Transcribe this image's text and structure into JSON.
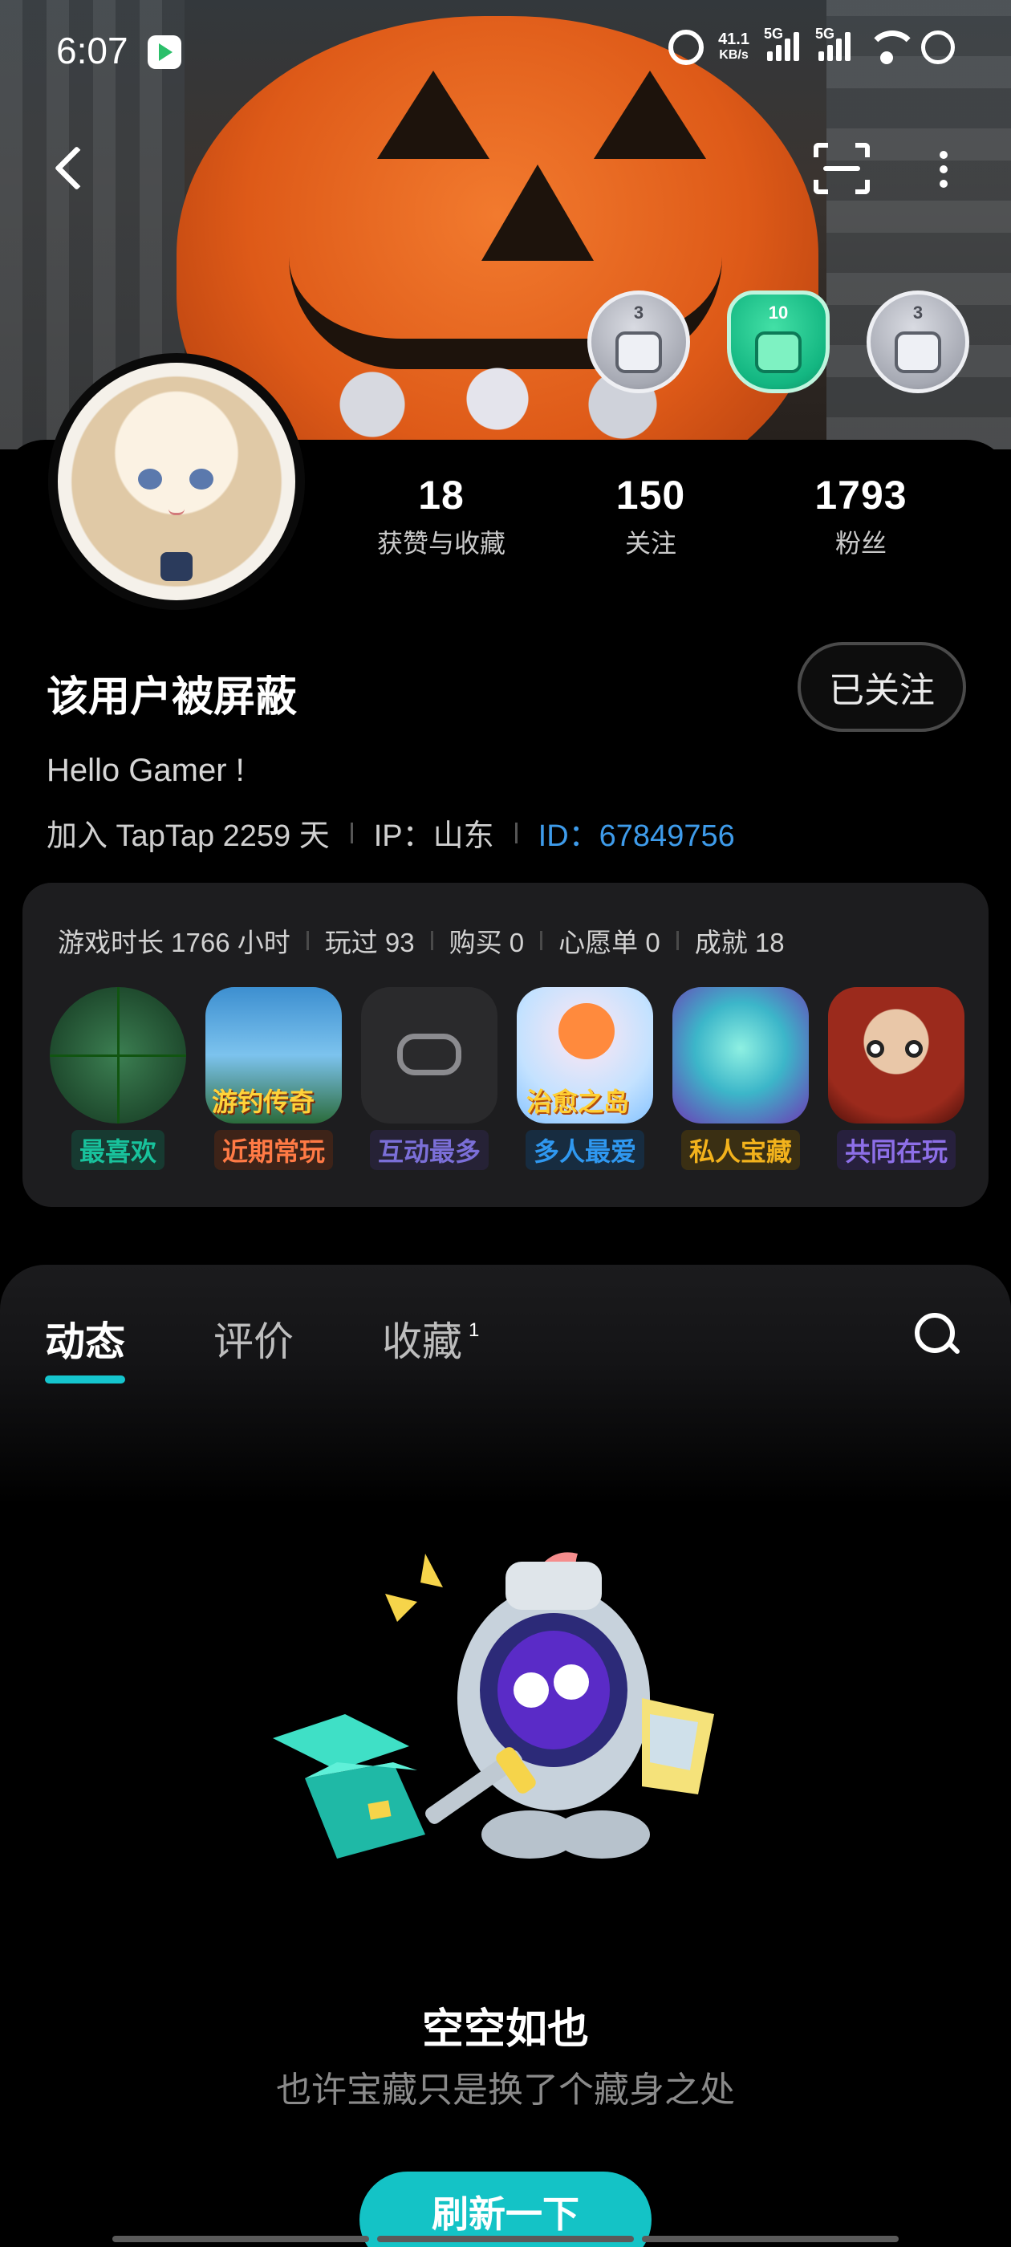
{
  "status_bar": {
    "time": "6:07",
    "net_speed_top": "41.1",
    "net_speed_unit": "KB/s",
    "sig1_label": "5G",
    "sig2_label": "5G"
  },
  "badges": [
    {
      "level": "3",
      "icon": "thumbs-up-badge-icon"
    },
    {
      "level": "10",
      "icon": "thumbs-up-badge-icon"
    },
    {
      "level": "3",
      "icon": "trophy-badge-icon"
    }
  ],
  "profile": {
    "username": "该用户被屏蔽",
    "follow_label": "已关注",
    "bio": "Hello Gamer !",
    "join_text": "加入 TapTap 2259 天",
    "ip_text": "IP：山东",
    "id_text": "ID：67849756"
  },
  "stats": [
    {
      "value": "18",
      "label": "获赞与收藏"
    },
    {
      "value": "150",
      "label": "关注"
    },
    {
      "value": "1793",
      "label": "粉丝"
    }
  ],
  "game_summary": [
    "游戏时长 1766 小时",
    "玩过 93",
    "购买 0",
    "心愿单 0",
    "成就 18"
  ],
  "games": [
    {
      "tag": "最喜欢",
      "tag_color": "#18c29c",
      "tag_bg": "#173a31",
      "icon_text": ""
    },
    {
      "tag": "近期常玩",
      "tag_color": "#ff7a45",
      "tag_bg": "#3d2318",
      "icon_text": "游钓传奇"
    },
    {
      "tag": "互动最多",
      "tag_color": "#7b6fd8",
      "tag_bg": "#262236",
      "icon_text": ""
    },
    {
      "tag": "多人最爱",
      "tag_color": "#2f98f0",
      "tag_bg": "#172c40",
      "icon_text": "治愈之岛"
    },
    {
      "tag": "私人宝藏",
      "tag_color": "#f2b21c",
      "tag_bg": "#3a2f13",
      "icon_text": ""
    },
    {
      "tag": "共同在玩",
      "tag_color": "#8d6fe8",
      "tag_bg": "#27203d",
      "icon_text": ""
    }
  ],
  "tabs": [
    {
      "label": "动态",
      "active": true
    },
    {
      "label": "评价",
      "active": false
    },
    {
      "label": "收藏",
      "active": false,
      "count": "1"
    }
  ],
  "empty_state": {
    "title": "空空如也",
    "subtitle": "也许宝藏只是换了个藏身之处",
    "refresh_label": "刷新一下"
  }
}
